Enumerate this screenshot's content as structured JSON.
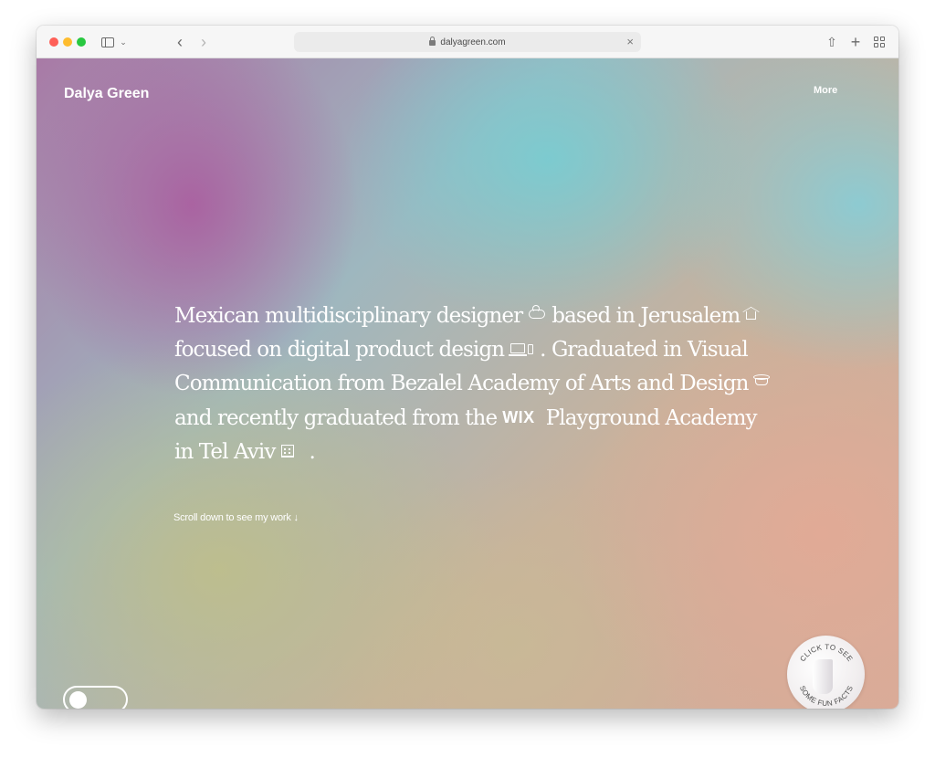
{
  "browser": {
    "url": "dalyagreen.com"
  },
  "header": {
    "brand": "Dalya Green",
    "more_label": "More"
  },
  "intro": {
    "line1_a": "Mexican multidisciplinary designer",
    "line1_b": "based in Jerusalem",
    "line2_a": "focused on digital product design",
    "line2_b": ". Graduated in Visual",
    "line3_a": "Communication from Bezalel Academy of Arts and Design",
    "line4_a": "and recently graduated from the",
    "line4_logo": "WIX",
    "line4_b": "Playground Academy",
    "line5_a": "in Tel Aviv",
    "line5_b": "."
  },
  "scroll_hint": "Scroll down to see my work ↓",
  "fun_facts": {
    "top_text": "CLICK TO SEE",
    "bottom_text": "SOME FUN FACTS"
  },
  "icons": {
    "cloud": "cloud-icon",
    "house": "house-icon",
    "laptop": "laptop-icon",
    "phone": "phone-icon",
    "graduation": "graduation-cap-icon",
    "building": "building-icon"
  },
  "colors": {
    "text": "#ffffff",
    "purple": "#aa60a0",
    "teal": "#78cdd2",
    "peach": "#e2aa96",
    "olive": "#bebe8c"
  }
}
